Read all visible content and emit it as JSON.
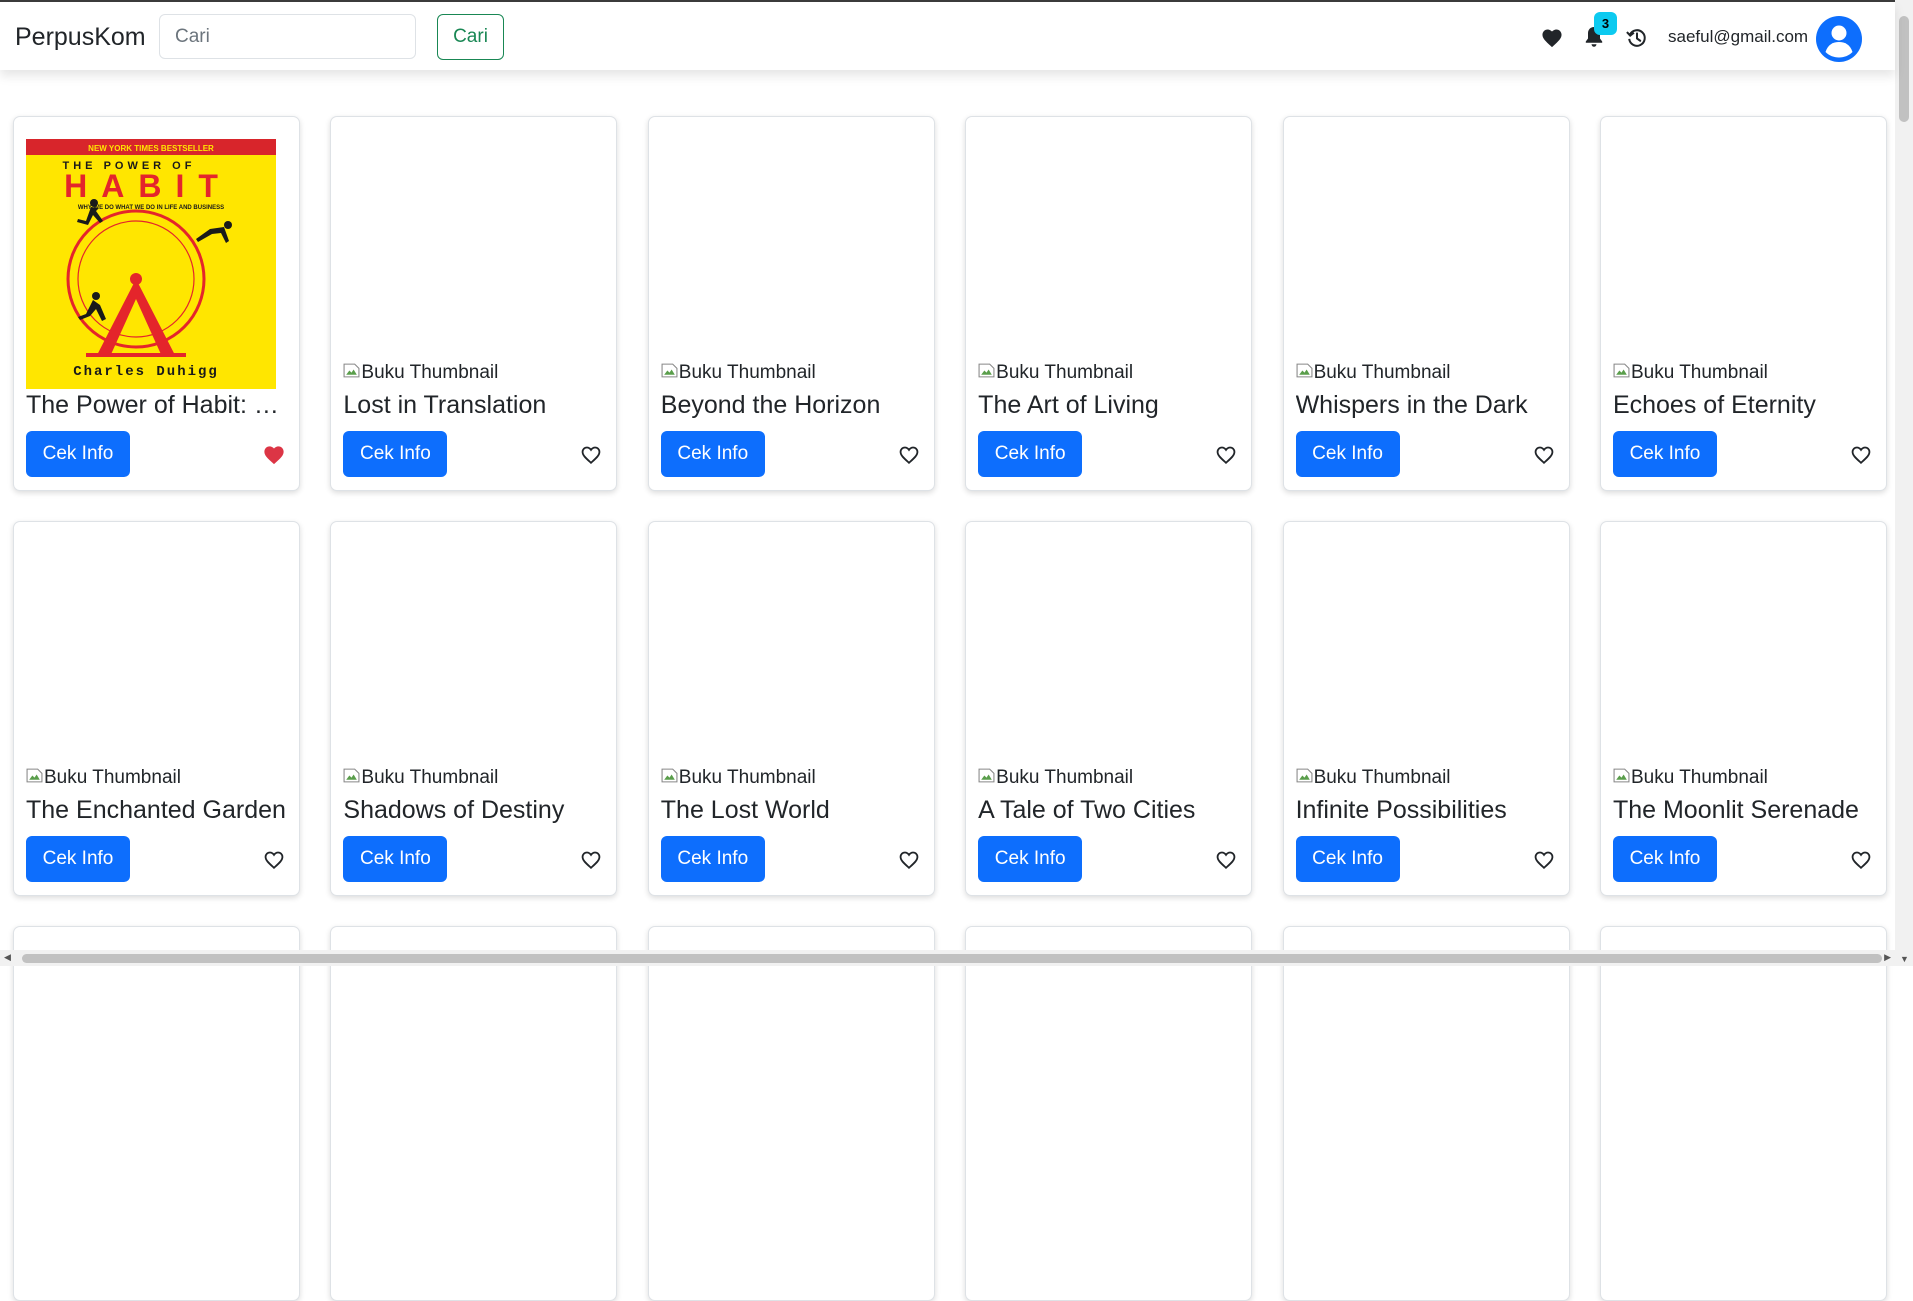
{
  "navbar": {
    "brand": "PerpusKom",
    "search_placeholder": "Cari",
    "search_button": "Cari",
    "notification_count": "3",
    "user_email": "saeful@gmail.com"
  },
  "cover": {
    "tagline": "NEW YORK TIMES BESTSELLER",
    "line1": "THE POWER OF",
    "line2": "HABIT",
    "subtitle": "WHY WE DO WHAT WE DO IN LIFE AND BUSINESS",
    "author": "Charles Duhigg"
  },
  "thumbnail_alt": "Buku Thumbnail",
  "button_label": "Cek Info",
  "colors": {
    "primary": "#0d6efd",
    "success": "#198754",
    "badge": "#0dcaf0",
    "favorite": "#dc3545"
  },
  "books": [
    {
      "title": "The Power of Habit: What We Do in Life and Business",
      "has_cover": true,
      "favorited": true
    },
    {
      "title": "Lost in Translation",
      "has_cover": false,
      "favorited": false
    },
    {
      "title": "Beyond the Horizon",
      "has_cover": false,
      "favorited": false
    },
    {
      "title": "The Art of Living",
      "has_cover": false,
      "favorited": false
    },
    {
      "title": "Whispers in the Dark",
      "has_cover": false,
      "favorited": false
    },
    {
      "title": "Echoes of Eternity",
      "has_cover": false,
      "favorited": false
    },
    {
      "title": "The Enchanted Garden",
      "has_cover": false,
      "favorited": false
    },
    {
      "title": "Shadows of Destiny",
      "has_cover": false,
      "favorited": false
    },
    {
      "title": "The Lost World",
      "has_cover": false,
      "favorited": false
    },
    {
      "title": "A Tale of Two Cities",
      "has_cover": false,
      "favorited": false
    },
    {
      "title": "Infinite Possibilities",
      "has_cover": false,
      "favorited": false
    },
    {
      "title": "The Moonlit Serenade",
      "has_cover": false,
      "favorited": false
    }
  ]
}
